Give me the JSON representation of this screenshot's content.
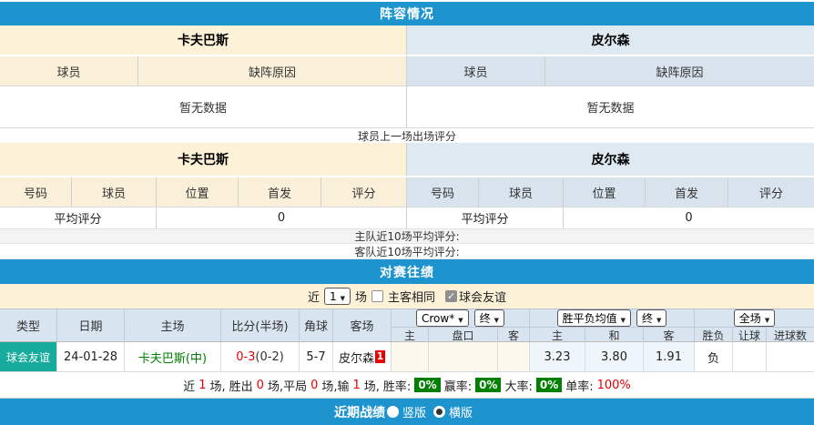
{
  "lineup": {
    "title": "阵容情况",
    "home_name": "卡夫巴斯",
    "away_name": "皮尔森",
    "col_player": "球员",
    "col_reason": "缺阵原因",
    "no_data": "暂无数据"
  },
  "rating": {
    "note": "球员上一场出场评分",
    "home_name": "卡夫巴斯",
    "away_name": "皮尔森",
    "cols": [
      "号码",
      "球员",
      "位置",
      "首发",
      "评分"
    ],
    "avg_label": "平均评分",
    "home_avg": "0",
    "away_avg": "0",
    "home_last10": "主队近10场平均评分:",
    "away_last10": "客队近10场平均评分:"
  },
  "h2h": {
    "title": "对赛往绩",
    "filter": {
      "near_label": "近",
      "count_value": "1",
      "matches_label": "场",
      "same_venue_label": "主客相同",
      "club_friendly_label": "球会友谊"
    },
    "header": {
      "type": "类型",
      "date": "日期",
      "home": "主场",
      "score": "比分(半场)",
      "corner": "角球",
      "away": "客场",
      "bookmaker_select": "Crow*",
      "final_select1": "终",
      "avg_select": "胜平负均值",
      "final_select2": "终",
      "scope_select": "全场",
      "sub": [
        "主",
        "盘口",
        "客",
        "主",
        "和",
        "客",
        "胜负",
        "让球",
        "进球数"
      ]
    },
    "row": {
      "type": "球会友谊",
      "date": "24-01-28",
      "home": "卡夫巴斯(中)",
      "score": "0-3",
      "half_score": "(0-2)",
      "corner": "5-7",
      "away": "皮尔森",
      "away_sup": "1",
      "odds_home": "3.23",
      "odds_draw": "3.80",
      "odds_away": "1.91",
      "result": "负"
    },
    "summary": {
      "t1": "近",
      "n1": "1",
      "t2": "场,",
      "t3": "胜出",
      "n2": "0",
      "t4": "场,平局",
      "n3": "0",
      "t5": "场,输",
      "n4": "1",
      "t6": "场,",
      "winrate_label": "胜率:",
      "winrate": "0%",
      "oddswin_label": "赢率:",
      "oddswin": "0%",
      "over_label": "大率:",
      "over": "0%",
      "single_label": "单率:",
      "single": "100%"
    }
  },
  "recent": {
    "title": "近期战绩",
    "vertical_label": "竖版",
    "horizontal_label": "横版"
  },
  "colors": {
    "header_blue": "#1e94cf",
    "cream": "#fdf2d8",
    "light_blue": "#dfe9f2",
    "teal": "#16ab9c",
    "red": "#e60000",
    "green": "#008000",
    "odds_blue": "#3a6ec4"
  }
}
